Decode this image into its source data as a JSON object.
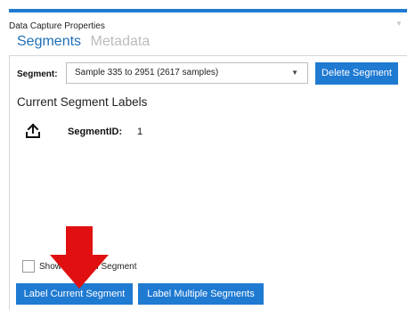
{
  "window": {
    "title": "Data Capture Properties"
  },
  "tabs": [
    {
      "label": "Segments",
      "active": true
    },
    {
      "label": "Metadata",
      "active": false
    }
  ],
  "segment": {
    "label": "Segment:",
    "selected": "Sample 335 to 2951 (2617 samples)",
    "delete_button": "Delete Segment"
  },
  "labels_section": {
    "title": "Current Segment Labels",
    "items": [
      {
        "icon": "upload-icon",
        "key": "SegmentID:",
        "value": "1"
      }
    ]
  },
  "options": {
    "show_selected_label": "Show Selected Segment",
    "show_selected_checked": false
  },
  "actions": {
    "label_current": "Label Current Segment",
    "label_multiple": "Label Multiple Segments"
  },
  "colors": {
    "accent": "#1f7ad2",
    "annotation_arrow": "#e01010"
  }
}
